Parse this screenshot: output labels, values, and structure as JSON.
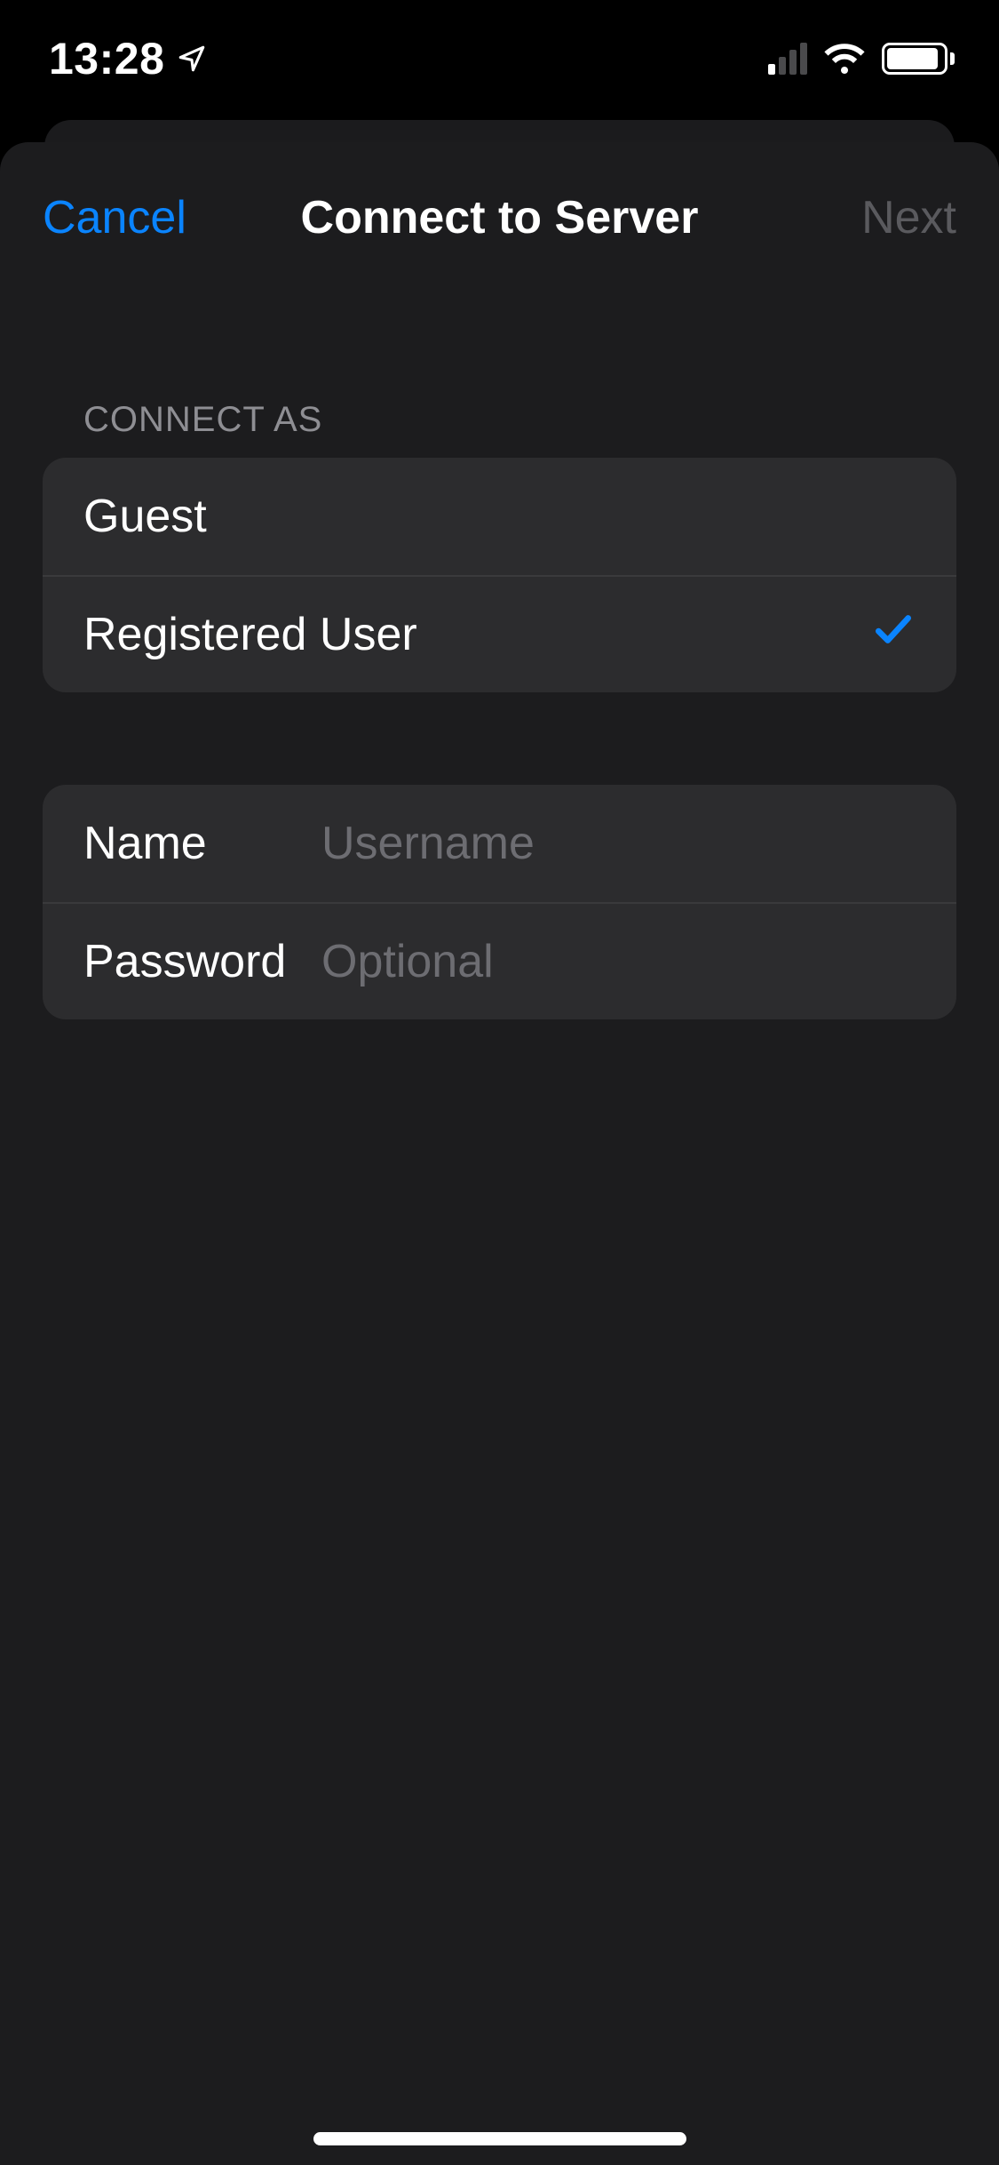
{
  "status": {
    "time": "13:28"
  },
  "nav": {
    "cancel": "Cancel",
    "title": "Connect to Server",
    "next": "Next"
  },
  "section_header": "Connect As",
  "connect_as": {
    "guest": "Guest",
    "registered": "Registered User",
    "selected": "registered"
  },
  "fields": {
    "name_label": "Name",
    "name_placeholder": "Username",
    "name_value": "",
    "password_label": "Password",
    "password_placeholder": "Optional",
    "password_value": ""
  },
  "colors": {
    "accent": "#0a84ff",
    "sheet_bg": "#1c1c1e",
    "group_bg": "#2c2c2e",
    "separator": "#3a3a3c",
    "secondary_text": "#8e8e93",
    "disabled_text": "#5a5a5e",
    "placeholder": "#6d6d72"
  }
}
